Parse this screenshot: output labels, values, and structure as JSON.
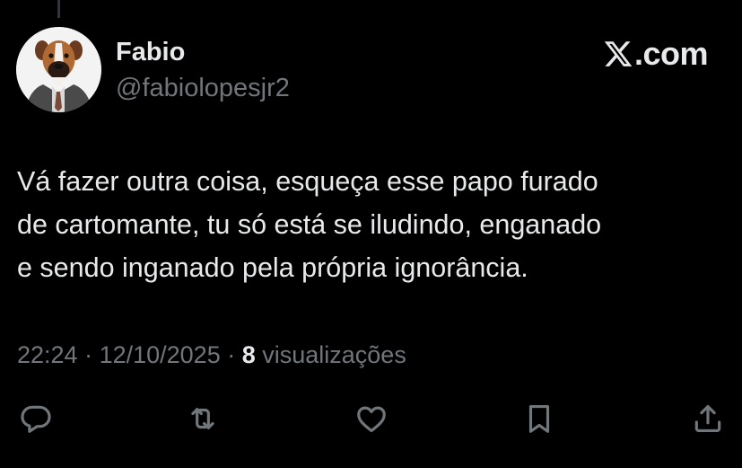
{
  "author": {
    "display_name": "Fabio",
    "handle": "@fabiolopesjr2",
    "avatar_icon": "boxer-dog-in-suit-avatar"
  },
  "brand": {
    "text": ".com",
    "icon": "x-logo-icon"
  },
  "tweet": {
    "text": "Vá fazer outra coisa, esqueça esse papo furado\nde cartomante, tu só está se iludindo, enganado\ne sendo inganado pela própria ignorância."
  },
  "meta": {
    "time": "22:24",
    "separator1": " · ",
    "date": "12/10/2025",
    "separator2": " · ",
    "views_count": "8",
    "views_label": " visualizações"
  },
  "actions": [
    {
      "name": "reply",
      "icon": "reply-icon"
    },
    {
      "name": "retweet",
      "icon": "retweet-icon"
    },
    {
      "name": "like",
      "icon": "heart-icon"
    },
    {
      "name": "bookmark",
      "icon": "bookmark-icon"
    },
    {
      "name": "share",
      "icon": "share-icon"
    }
  ],
  "colors": {
    "background": "#000000",
    "primary_text": "#e7e9ea",
    "secondary_text": "#71767b"
  }
}
